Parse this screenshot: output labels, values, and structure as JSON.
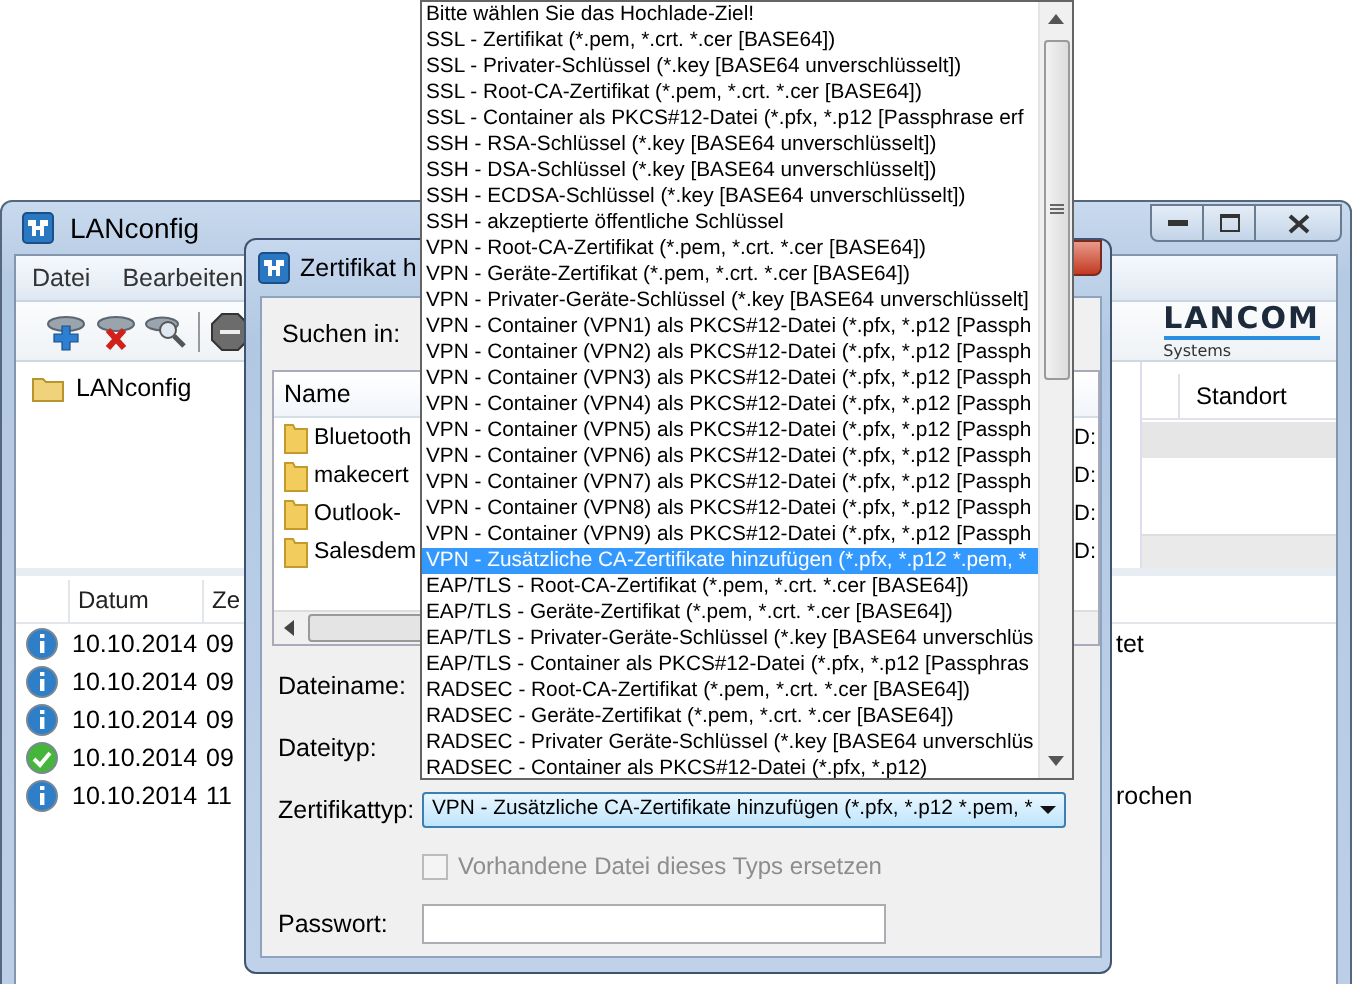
{
  "main_window": {
    "title": "LANconfig",
    "menu": [
      {
        "label": "Datei"
      },
      {
        "label": "Bearbeiten"
      }
    ],
    "logo": {
      "name": "LANCOM",
      "subtitle": "Systems"
    },
    "tree": [
      {
        "label": "LANconfig"
      }
    ],
    "device_list": {
      "columns": [
        "Standort"
      ]
    },
    "log": {
      "columns": [
        "Datum",
        "Ze"
      ],
      "rows": [
        {
          "kind": "info",
          "date": "10.10.2014",
          "time": "09",
          "message": "tet"
        },
        {
          "kind": "info",
          "date": "10.10.2014",
          "time": "09"
        },
        {
          "kind": "info",
          "date": "10.10.2014",
          "time": "09"
        },
        {
          "kind": "success",
          "date": "10.10.2014",
          "time": "09"
        },
        {
          "kind": "info",
          "date": "10.10.2014",
          "time": "11",
          "message": "rochen"
        }
      ]
    }
  },
  "dialog": {
    "title": "Zertifikat h",
    "search_label": "Suchen in:",
    "file_list": {
      "columns": [
        "Name"
      ],
      "rows": [
        {
          "name": "Bluetooth",
          "column_2": "D:"
        },
        {
          "name": "makecert",
          "column_2": "D:"
        },
        {
          "name": "Outlook-",
          "column_2": "D:"
        },
        {
          "name": "Salesdem",
          "column_2": "D:"
        }
      ]
    },
    "filename_label": "Dateiname:",
    "filetype_label": "Dateityp:",
    "cert_type": {
      "label": "Zertifikattyp:",
      "value": "VPN - Zusätzliche CA-Zertifikate hinzufügen (*.pfx, *.p12 *.pem, *"
    },
    "replace_checkbox": {
      "label": "Vorhandene Datei dieses Typs ersetzen",
      "checked": false,
      "disabled": true
    },
    "password": {
      "label": "Passwort:"
    }
  },
  "dropdown": {
    "items": [
      {
        "label": "Bitte wählen Sie das Hochlade-Ziel!",
        "selected": false
      },
      {
        "label": "SSL - Zertifikat (*.pem, *.crt. *.cer [BASE64])",
        "selected": false
      },
      {
        "label": "SSL - Privater-Schlüssel (*.key [BASE64 unverschlüsselt])",
        "selected": false
      },
      {
        "label": "SSL - Root-CA-Zertifikat (*.pem, *.crt. *.cer [BASE64])",
        "selected": false
      },
      {
        "label": "SSL - Container als PKCS#12-Datei (*.pfx, *.p12 [Passphrase erf",
        "selected": false
      },
      {
        "label": "SSH - RSA-Schlüssel (*.key [BASE64 unverschlüsselt])",
        "selected": false
      },
      {
        "label": "SSH - DSA-Schlüssel (*.key [BASE64 unverschlüsselt])",
        "selected": false
      },
      {
        "label": "SSH - ECDSA-Schlüssel (*.key [BASE64 unverschlüsselt])",
        "selected": false
      },
      {
        "label": "SSH - akzeptierte öffentliche Schlüssel",
        "selected": false
      },
      {
        "label": "VPN - Root-CA-Zertifikat (*.pem, *.crt. *.cer [BASE64])",
        "selected": false
      },
      {
        "label": "VPN - Geräte-Zertifikat (*.pem, *.crt. *.cer [BASE64])",
        "selected": false
      },
      {
        "label": "VPN - Privater-Geräte-Schlüssel (*.key [BASE64 unverschlüsselt]",
        "selected": false
      },
      {
        "label": "VPN - Container (VPN1) als PKCS#12-Datei (*.pfx, *.p12 [Passph",
        "selected": false
      },
      {
        "label": "VPN - Container (VPN2) als PKCS#12-Datei (*.pfx, *.p12 [Passph",
        "selected": false
      },
      {
        "label": "VPN - Container (VPN3) als PKCS#12-Datei (*.pfx, *.p12 [Passph",
        "selected": false
      },
      {
        "label": "VPN - Container (VPN4) als PKCS#12-Datei (*.pfx, *.p12 [Passph",
        "selected": false
      },
      {
        "label": "VPN - Container (VPN5) als PKCS#12-Datei (*.pfx, *.p12 [Passph",
        "selected": false
      },
      {
        "label": "VPN - Container (VPN6) als PKCS#12-Datei (*.pfx, *.p12 [Passph",
        "selected": false
      },
      {
        "label": "VPN - Container (VPN7) als PKCS#12-Datei (*.pfx, *.p12 [Passph",
        "selected": false
      },
      {
        "label": "VPN - Container (VPN8) als PKCS#12-Datei (*.pfx, *.p12 [Passph",
        "selected": false
      },
      {
        "label": "VPN - Container (VPN9) als PKCS#12-Datei (*.pfx, *.p12 [Passph",
        "selected": false
      },
      {
        "label": "VPN - Zusätzliche CA-Zertifikate hinzufügen (*.pfx, *.p12 *.pem, *",
        "selected": true
      },
      {
        "label": "EAP/TLS - Root-CA-Zertifikat (*.pem, *.crt. *.cer [BASE64])",
        "selected": false
      },
      {
        "label": "EAP/TLS - Geräte-Zertifikat (*.pem, *.crt. *.cer [BASE64])",
        "selected": false
      },
      {
        "label": "EAP/TLS - Privater-Geräte-Schlüssel (*.key [BASE64 unverschlüs",
        "selected": false
      },
      {
        "label": "EAP/TLS - Container als PKCS#12-Datei (*.pfx, *.p12 [Passphras",
        "selected": false
      },
      {
        "label": "RADSEC - Root-CA-Zertifikat (*.pem, *.crt. *.cer [BASE64])",
        "selected": false
      },
      {
        "label": "RADSEC - Geräte-Zertifikat (*.pem, *.crt. *.cer [BASE64])",
        "selected": false
      },
      {
        "label": "RADSEC - Privater Geräte-Schlüssel (*.key [BASE64 unverschlüs",
        "selected": false
      },
      {
        "label": "RADSEC - Container als PKCS#12-Datei (*.pfx, *.p12)",
        "selected": false
      }
    ]
  }
}
